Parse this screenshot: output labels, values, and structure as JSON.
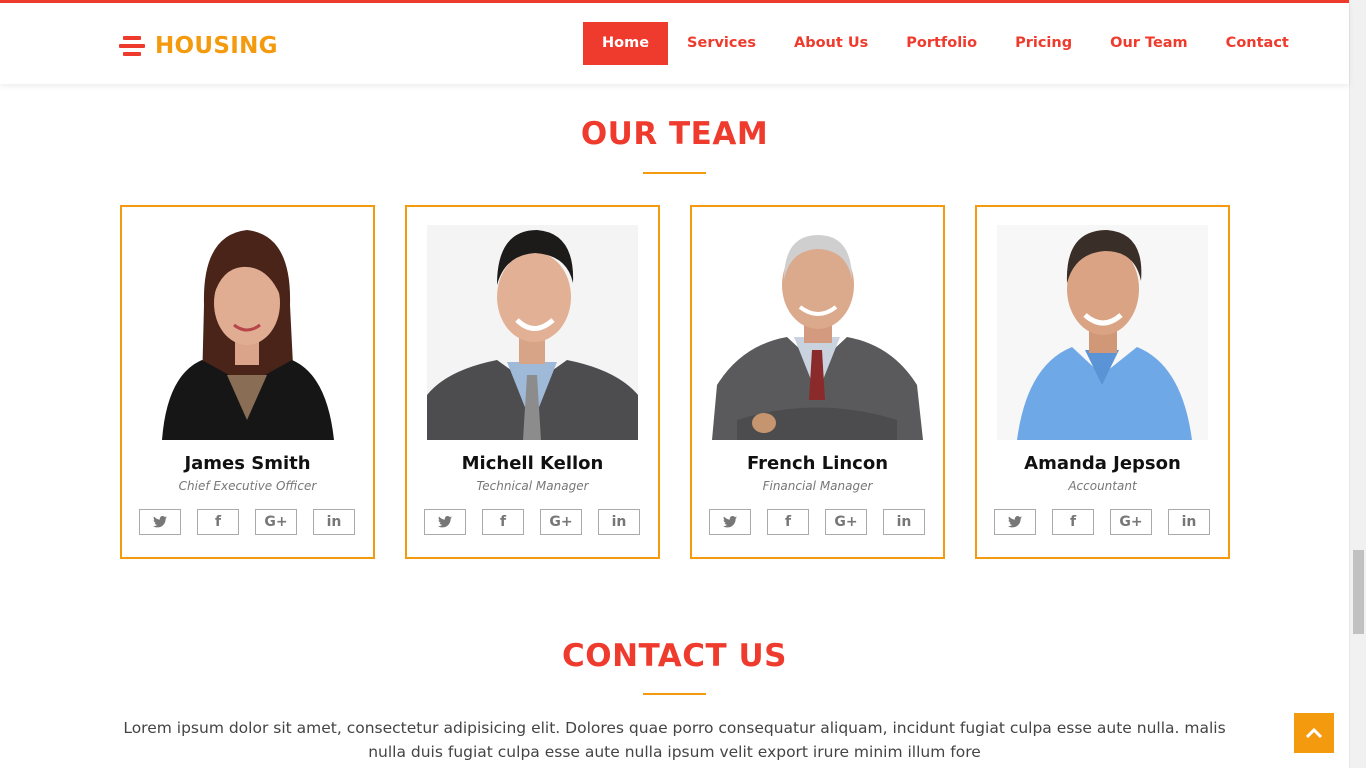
{
  "brand": {
    "name": "HOUSING",
    "accent": "#ef3b2d",
    "secondary": "#f39a0e"
  },
  "nav": {
    "items": [
      {
        "label": "Home",
        "active": true
      },
      {
        "label": "Services"
      },
      {
        "label": "About Us"
      },
      {
        "label": "Portfolio"
      },
      {
        "label": "Pricing"
      },
      {
        "label": "Our Team"
      },
      {
        "label": "Contact"
      }
    ]
  },
  "team": {
    "title": "OUR TEAM",
    "members": [
      {
        "name": "James Smith",
        "role": "Chief Executive Officer"
      },
      {
        "name": "Michell Kellon",
        "role": "Technical Manager"
      },
      {
        "name": "French Lincon",
        "role": "Financial Manager"
      },
      {
        "name": "Amanda Jepson",
        "role": "Accountant"
      }
    ],
    "social_icons": [
      "twitter-icon",
      "facebook-icon",
      "google-plus-icon",
      "linkedin-icon"
    ],
    "social_glyphs": {
      "twitter": "🐦",
      "facebook": "f",
      "google": "G+",
      "linkedin": "in"
    }
  },
  "contact": {
    "title": "CONTACT US",
    "text": "Lorem ipsum dolor sit amet, consectetur adipisicing elit. Dolores quae porro consequatur aliquam, incidunt fugiat culpa esse aute nulla. malis nulla duis fugiat culpa esse aute nulla ipsum velit export irure minim illum fore"
  }
}
